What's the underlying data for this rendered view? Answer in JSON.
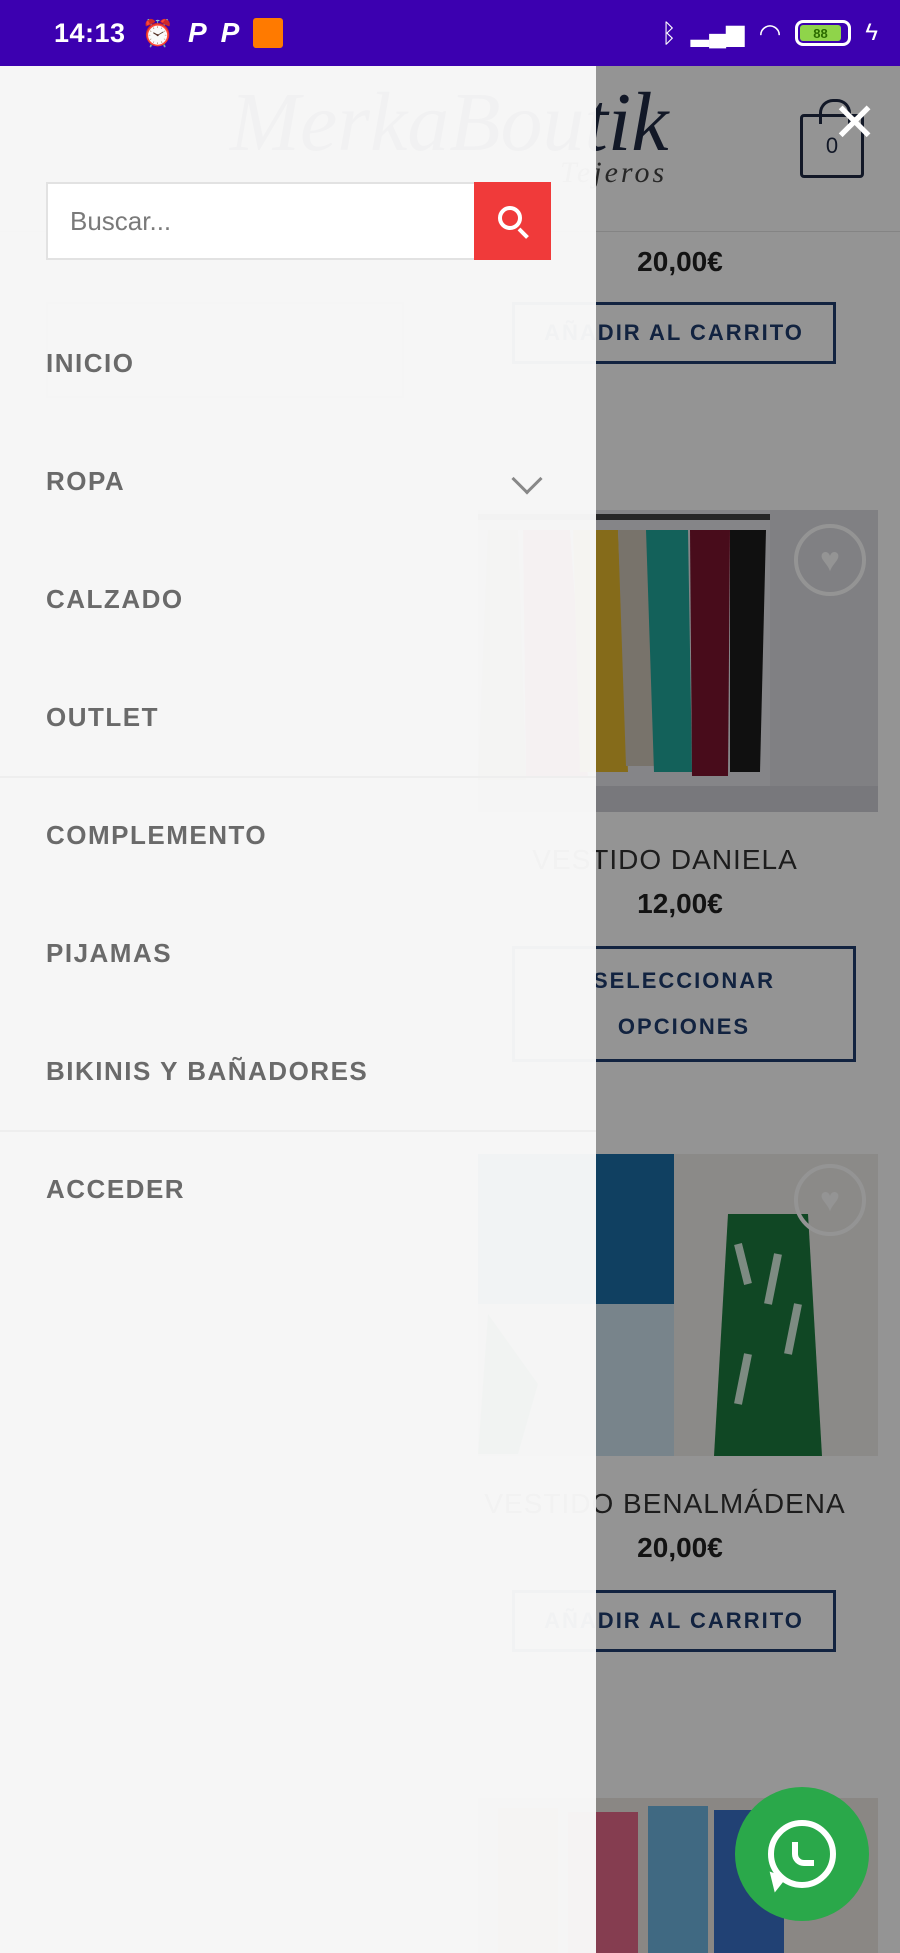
{
  "status_bar": {
    "time": "14:13",
    "battery": "88"
  },
  "header": {
    "logo_text": "MerkaBoutik",
    "logo_subtitle": "Tejeros",
    "cart_count": "0"
  },
  "products": [
    {
      "price": "20,00€",
      "button": "AÑADIR AL CARRITO"
    },
    {
      "name": "VESTIDO DANIELA",
      "price": "12,00€",
      "button_line1": "SELECCIONAR",
      "button_line2": "OPCIONES"
    },
    {
      "name": "VESTIDO BENALMÁDENA",
      "price": "20,00€",
      "button": "AÑADIR AL CARRITO"
    }
  ],
  "drawer": {
    "search_placeholder": "Buscar...",
    "menu": [
      {
        "label": "INICIO"
      },
      {
        "label": "ROPA"
      },
      {
        "label": "CALZADO"
      },
      {
        "label": "OUTLET"
      },
      {
        "label": "COMPLEMENTO"
      },
      {
        "label": "PIJAMAS"
      },
      {
        "label": "BIKINIS Y BAÑADORES"
      },
      {
        "label": "ACCEDER"
      }
    ]
  },
  "colors": {
    "status_bar": "#3c00b0",
    "search_button": "#f03a3a",
    "whatsapp": "#2aa84a"
  }
}
